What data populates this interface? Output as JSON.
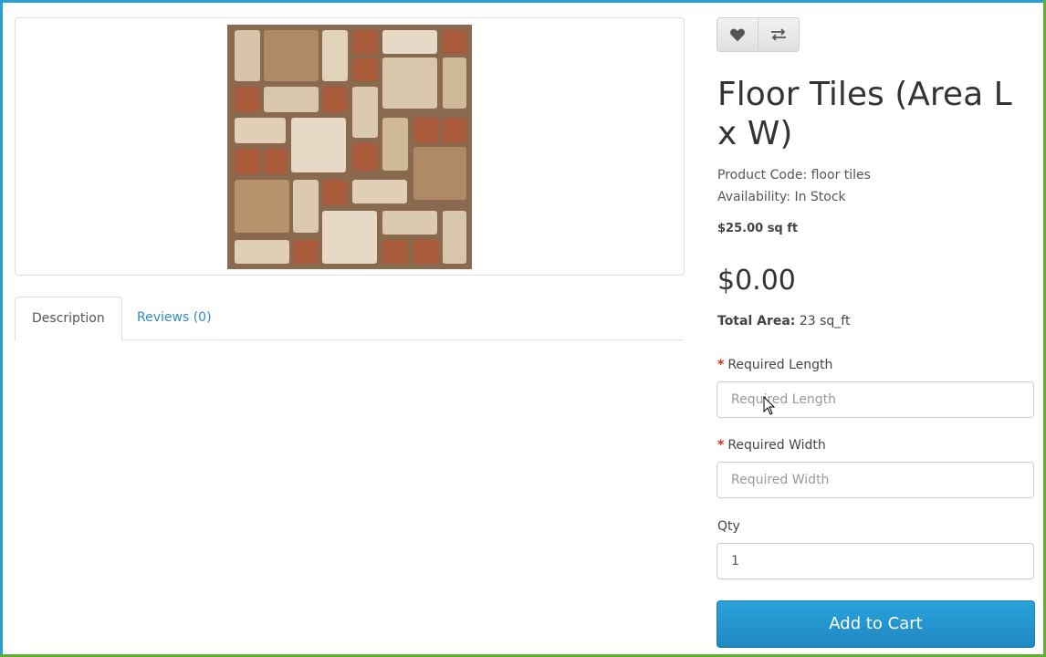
{
  "product": {
    "title": "Floor Tiles (Area L x W)",
    "code_text": "Product Code: floor tiles",
    "availability_text": "Availability: In Stock",
    "unit_price": "$25.00 sq ft",
    "price": "$0.00",
    "total_area_label": "Total Area:",
    "total_area_value": "23 sq_ft"
  },
  "tabs": {
    "description": "Description",
    "reviews": "Reviews (0)"
  },
  "options": {
    "length_label": "Required Length",
    "length_placeholder": "Required Length",
    "width_label": "Required Width",
    "width_placeholder": "Required Width",
    "required_mark": "*",
    "qty_label": "Qty",
    "qty_value": "1"
  },
  "actions": {
    "add_to_cart": "Add to Cart",
    "wishlist_icon": "heart-icon",
    "compare_icon": "exchange-icon"
  },
  "colors": {
    "accent": "#1f87c2",
    "required": "#e1261c"
  }
}
